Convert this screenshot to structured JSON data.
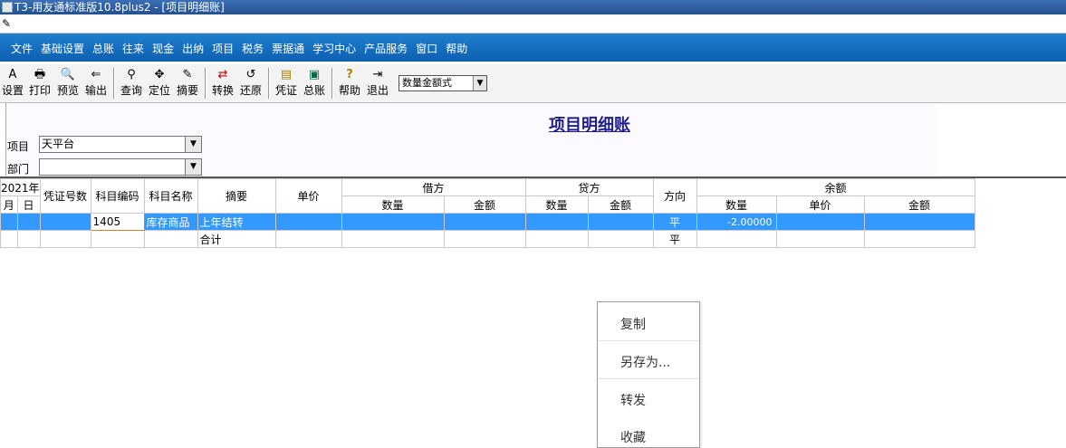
{
  "window": {
    "title": "T3-用友通标准版10.8plus2 - [项目明细账]"
  },
  "menu": [
    "文件",
    "基础设置",
    "总账",
    "往来",
    "现金",
    "出纳",
    "项目",
    "税务",
    "票据通",
    "学习中心",
    "产品服务",
    "窗口",
    "帮助"
  ],
  "toolbar": {
    "buttons": [
      {
        "label": "设置",
        "icon": "A"
      },
      {
        "label": "打印",
        "icon": "🖶"
      },
      {
        "label": "预览",
        "icon": "🔍"
      },
      {
        "label": "输出",
        "icon": "⇐"
      },
      {
        "label": "查询",
        "icon": "⚲"
      },
      {
        "label": "定位",
        "icon": "✥"
      },
      {
        "label": "摘要",
        "icon": "✎"
      },
      {
        "label": "转换",
        "icon": "⇄"
      },
      {
        "label": "还原",
        "icon": "↺"
      },
      {
        "label": "凭证",
        "icon": "▤"
      },
      {
        "label": "总账",
        "icon": "▣"
      },
      {
        "label": "帮助",
        "icon": "?"
      },
      {
        "label": "退出",
        "icon": "⇥"
      }
    ],
    "format_select": "数量金额式"
  },
  "report": {
    "title": "项目明细账",
    "project_label": "项目",
    "project_value": "天平台",
    "dept_label": "部门",
    "dept_value": ""
  },
  "table": {
    "year": "2021年",
    "month": "月",
    "day": "日",
    "voucher_no": "凭证号数",
    "subject_code": "科目编码",
    "subject_name": "科目名称",
    "summary": "摘要",
    "unit_price": "单价",
    "debit": "借方",
    "credit": "贷方",
    "direction": "方向",
    "balance": "余额",
    "qty": "数量",
    "amount": "金额",
    "price": "单价",
    "rows": [
      {
        "code": "1405",
        "name": "库存商品",
        "summary": "上年结转",
        "direction": "平",
        "bal_qty": "-2.00000"
      },
      {
        "summary": "合计",
        "direction": "平"
      }
    ]
  },
  "context_menu": [
    "复制",
    "另存为...",
    "转发",
    "收藏"
  ]
}
